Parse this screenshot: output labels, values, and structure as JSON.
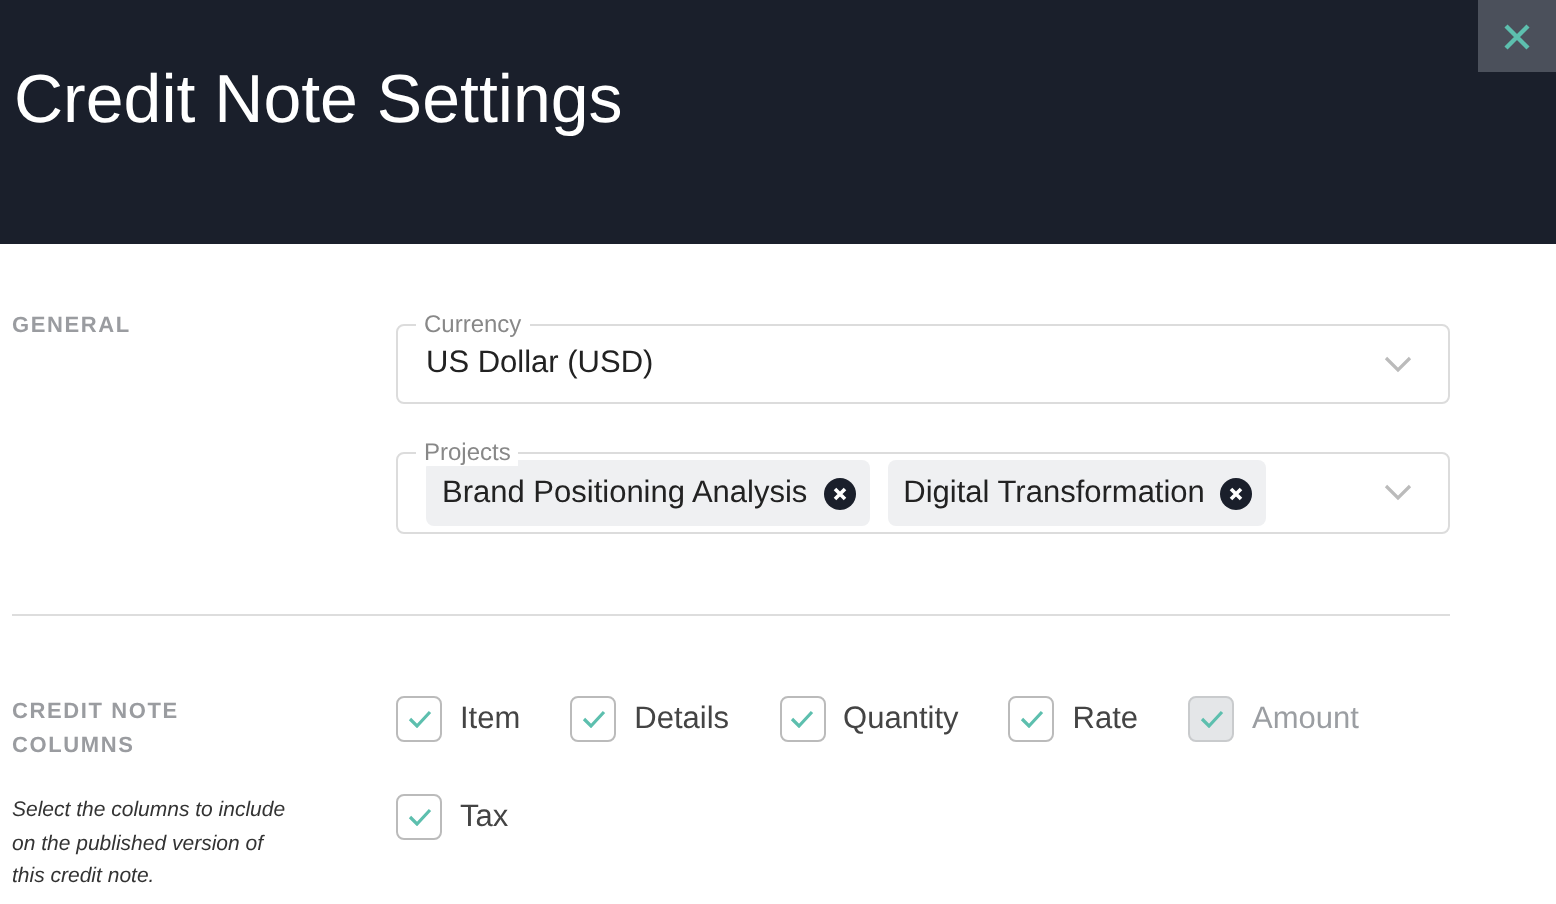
{
  "header": {
    "title": "Credit Note Settings"
  },
  "general": {
    "heading": "GENERAL",
    "currency": {
      "label": "Currency",
      "value": "US Dollar (USD)"
    },
    "projects": {
      "label": "Projects",
      "chips": [
        "Brand Positioning Analysis",
        "Digital Transformation"
      ]
    }
  },
  "columns": {
    "heading": "CREDIT NOTE COLUMNS",
    "description": "Select the columns to include on the published version of this credit note.",
    "options": [
      {
        "label": "Item",
        "checked": true,
        "disabled": false
      },
      {
        "label": "Details",
        "checked": true,
        "disabled": false
      },
      {
        "label": "Quantity",
        "checked": true,
        "disabled": false
      },
      {
        "label": "Rate",
        "checked": true,
        "disabled": false
      },
      {
        "label": "Amount",
        "checked": true,
        "disabled": true
      },
      {
        "label": "Tax",
        "checked": true,
        "disabled": false
      }
    ]
  }
}
